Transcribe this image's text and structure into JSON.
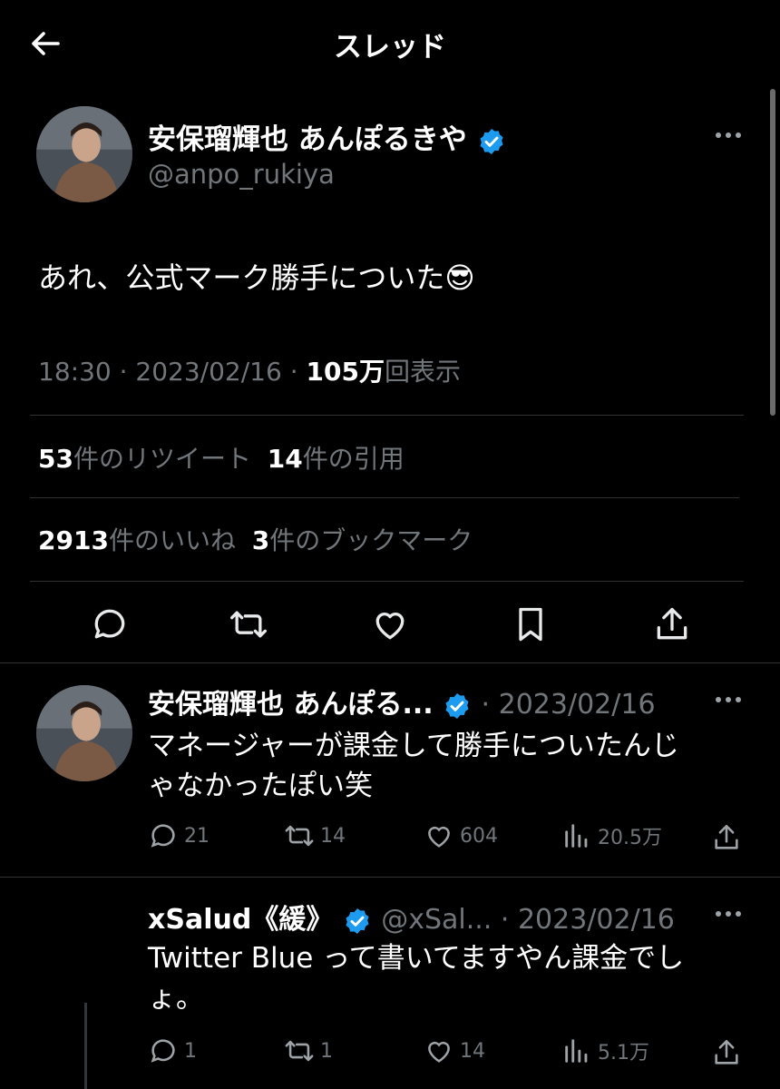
{
  "header": {
    "title": "スレッド"
  },
  "main_tweet": {
    "display_name": "安保瑠輝也 あんぽるきや",
    "handle": "@anpo_rukiya",
    "text": "あれ、公式マーク勝手についた😎",
    "time": "18:30",
    "date": "2023/02/16",
    "views_count": "105万",
    "views_label": "回表示",
    "retweets_count": "53",
    "retweets_label": "件のリツイート",
    "quotes_count": "14",
    "quotes_label": "件の引用",
    "likes_count": "2913",
    "likes_label": "件のいいね",
    "bookmarks_count": "3",
    "bookmarks_label": "件のブックマーク"
  },
  "replies": [
    {
      "display_name": "安保瑠輝也 あんぽる...",
      "date": "2023/02/16",
      "text_line1": "マネージャーが課金して勝手についたんじ",
      "text_line2": "ゃなかったぽい笑",
      "reply_count": "21",
      "retweet_count": "14",
      "like_count": "604",
      "view_count": "20.5万"
    },
    {
      "display_name": "xSalud《緩》",
      "handle": "@xSal...",
      "date": "2023/02/16",
      "text_line1": "Twitter Blue って書いてますやん課金でし",
      "text_line2": "ょ。",
      "reply_count": "1",
      "retweet_count": "1",
      "like_count": "14",
      "view_count": "5.1万"
    }
  ],
  "colors": {
    "background": "#000000",
    "text": "#e7e9ea",
    "muted": "#71767b",
    "verified": "#1d9bf0",
    "divider": "#2f3336"
  }
}
